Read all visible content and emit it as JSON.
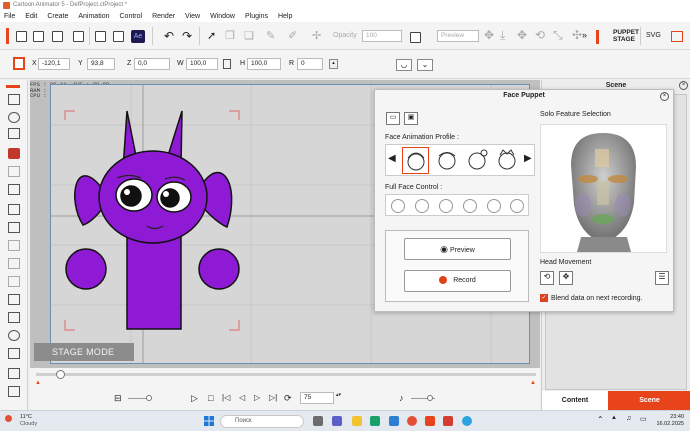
{
  "app": {
    "title": "Cartoon Animator 5 - DefProject.ctProject *"
  },
  "menu": [
    "File",
    "Edit",
    "Create",
    "Animation",
    "Control",
    "Render",
    "View",
    "Window",
    "Plugins",
    "Help"
  ],
  "toolbar1": {
    "opacity_label": "Opacity",
    "opacity_value": "100",
    "preview_value": "Preview",
    "puppet_stage_line1": "PUPPET",
    "puppet_stage_line2": "STAGE",
    "svg_label": "SVG"
  },
  "toolbar2": {
    "x_label": "X",
    "x_value": "-120,1",
    "y_label": "Y",
    "y_value": "93,8",
    "z_label": "Z",
    "z_value": "0,0",
    "w_label": "W",
    "w_value": "100,0",
    "h_label": "H",
    "h_value": "100,0",
    "r_label": "R",
    "r_value": "0"
  },
  "stats": {
    "line1": "FPS : 80.44, AVG : 88.09",
    "line2": "RAM : 1192MB",
    "line3": "CPU : 0.42%"
  },
  "stage": {
    "mode_label": "STAGE MODE"
  },
  "timeline": {
    "frame_value": "75"
  },
  "scene_panel": {
    "title": "Scene",
    "tab_content": "Content",
    "tab_scene": "Scene"
  },
  "face_puppet": {
    "title": "Face Puppet",
    "profile_label": "Face Animation Profile :",
    "full_face_label": "Full Face Control :",
    "preview_label": "Preview",
    "record_label": "Record",
    "solo_label": "Solo Feature Selection",
    "head_movement_label": "Head Movement",
    "blend_label": "Blend data on next recording."
  },
  "taskbar": {
    "weather_temp": "11°C",
    "weather_desc": "Cloudy",
    "search_placeholder": "Поиск",
    "time": "23:40",
    "date": "16.02.2025"
  },
  "colors": {
    "accent": "#e8441c",
    "character": "#8f1ad6",
    "record": "#e0431b"
  }
}
